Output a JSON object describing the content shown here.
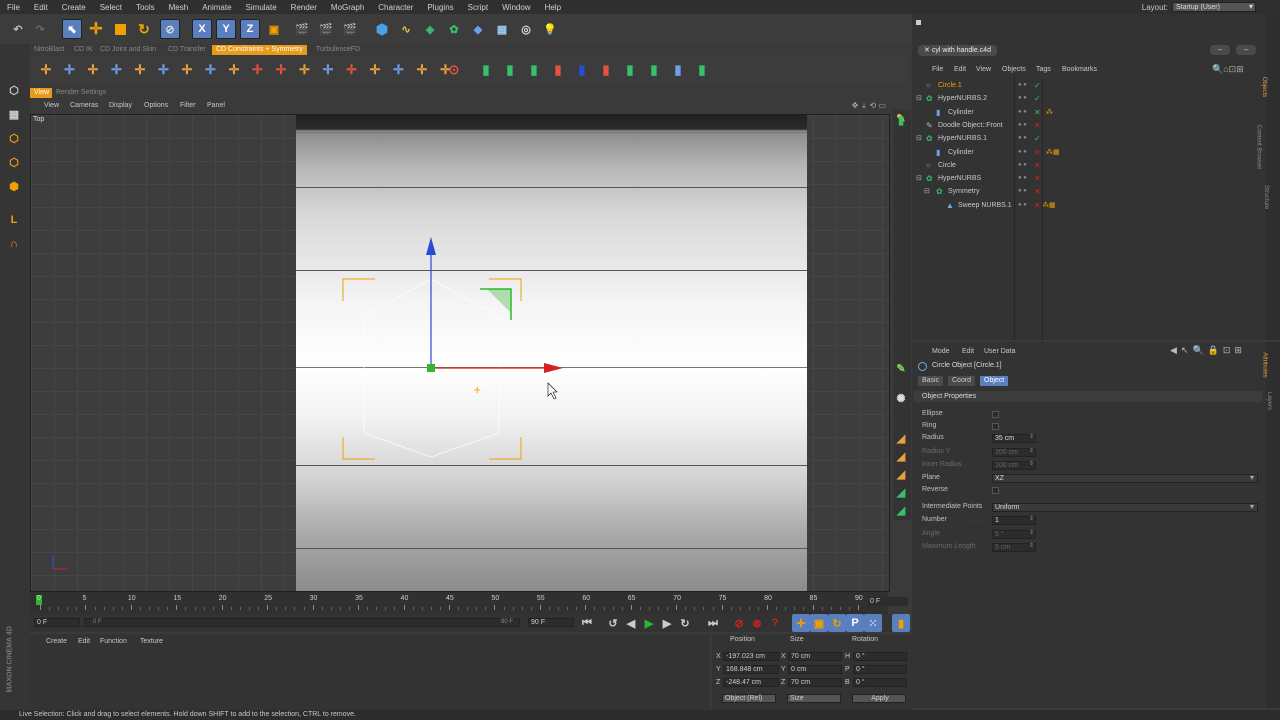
{
  "menu": [
    "File",
    "Edit",
    "Create",
    "Select",
    "Tools",
    "Mesh",
    "Animate",
    "Simulate",
    "Render",
    "MoGraph",
    "Character",
    "Plugins",
    "Script",
    "Window",
    "Help"
  ],
  "layout": {
    "label": "Layout:",
    "value": "Startup (User)"
  },
  "plugin_tabs": [
    "NitroBlast",
    "CD IK",
    "CD Joint and Skin",
    "CD Transfer",
    "CD Constraints + Symmetry",
    "TurbulenceFD"
  ],
  "plugin_tabs_active": 4,
  "viewport": {
    "tabs": [
      "View",
      "Render Settings"
    ],
    "menu": [
      "View",
      "Cameras",
      "Display",
      "Options",
      "Filter",
      "Panel"
    ],
    "label": "Top"
  },
  "objects": {
    "doc_tab": "cyl with handle.c4d",
    "menu": [
      "File",
      "Edit",
      "View",
      "Objects",
      "Tags",
      "Bookmarks"
    ],
    "rows": [
      {
        "name": "Circle.1",
        "indent": 0,
        "highlight": true,
        "icon": "circle-icon"
      },
      {
        "name": "HyperNURBS.2",
        "indent": 0,
        "icon": "hypernurbs-icon"
      },
      {
        "name": "Cylinder",
        "indent": 1,
        "icon": "cylinder-icon"
      },
      {
        "name": "Doodle Object::Front",
        "indent": 0,
        "icon": "doodle-icon"
      },
      {
        "name": "HyperNURBS.1",
        "indent": 0,
        "icon": "hypernurbs-icon"
      },
      {
        "name": "Cylinder",
        "indent": 1,
        "icon": "cylinder-icon"
      },
      {
        "name": "Circle",
        "indent": 0,
        "icon": "circle-icon"
      },
      {
        "name": "HyperNURBS",
        "indent": 0,
        "icon": "hypernurbs-icon"
      },
      {
        "name": "Symmetry",
        "indent": 1,
        "icon": "symmetry-icon"
      },
      {
        "name": "Sweep NURBS.1",
        "indent": 2,
        "icon": "sweep-icon"
      }
    ],
    "side_tabs": [
      "Objects",
      "Content Browser",
      "Structure"
    ]
  },
  "attributes": {
    "menu": [
      "Mode",
      "Edit",
      "User Data"
    ],
    "title": "Circle Object [Circle.1]",
    "tabs": [
      "Basic",
      "Coord",
      "Object"
    ],
    "active_tab": 2,
    "section": "Object Properties",
    "props": [
      {
        "label": "Ellipse",
        "type": "check"
      },
      {
        "label": "Ring",
        "type": "check"
      },
      {
        "label": "Radius",
        "type": "num",
        "value": "35 cm"
      },
      {
        "label": "Radius Y",
        "type": "num",
        "value": "200 cm",
        "disabled": true
      },
      {
        "label": "Inner Radius",
        "type": "num",
        "value": "100 cm",
        "disabled": true
      },
      {
        "label": "Plane",
        "type": "select",
        "value": "XZ"
      },
      {
        "label": "Reverse",
        "type": "check"
      },
      {
        "label": "Intermediate Points",
        "type": "select",
        "value": "Uniform"
      },
      {
        "label": "Number",
        "type": "num",
        "value": "1"
      },
      {
        "label": "Angle",
        "type": "num",
        "value": "5 °",
        "disabled": true
      },
      {
        "label": "Maximum Length",
        "type": "num",
        "value": "5 cm",
        "disabled": true
      }
    ],
    "side_tabs": [
      "Attributes",
      "Layers"
    ]
  },
  "timeline": {
    "ticks": [
      "0",
      "5",
      "10",
      "15",
      "20",
      "25",
      "30",
      "35",
      "40",
      "45",
      "50",
      "55",
      "60",
      "65",
      "70",
      "75",
      "80",
      "85",
      "90"
    ],
    "current": "0 F",
    "start": "0 F",
    "scroll_start": "0 F",
    "scroll_end": "90 F",
    "end": "90 F"
  },
  "material": {
    "menu": [
      "Create",
      "Edit",
      "Function",
      "Texture"
    ]
  },
  "coords": {
    "headers": [
      "Position",
      "Size",
      "Rotation"
    ],
    "rows": [
      {
        "axis": "X",
        "pos": "-197.023 cm",
        "size_axis": "X",
        "size": "70 cm",
        "rot_axis": "H",
        "rot": "0 °"
      },
      {
        "axis": "Y",
        "pos": "168.848 cm",
        "size_axis": "Y",
        "size": "0 cm",
        "rot_axis": "P",
        "rot": "0 °"
      },
      {
        "axis": "Z",
        "pos": "-248.47 cm",
        "size_axis": "Z",
        "size": "70 cm",
        "rot_axis": "B",
        "rot": "0 °"
      }
    ],
    "mode": "Object (Rel)",
    "size_mode": "Size",
    "apply": "Apply"
  },
  "brand": "MAXON CINEMA 4D",
  "status": "Live Selection: Click and drag to select elements. Hold down SHIFT to add to the selection, CTRL to remove.",
  "colors": {
    "accent": "#f0a000",
    "x_axis": "#d42020",
    "y_axis": "#2a4ad8",
    "z_axis": "#2fb82f"
  }
}
